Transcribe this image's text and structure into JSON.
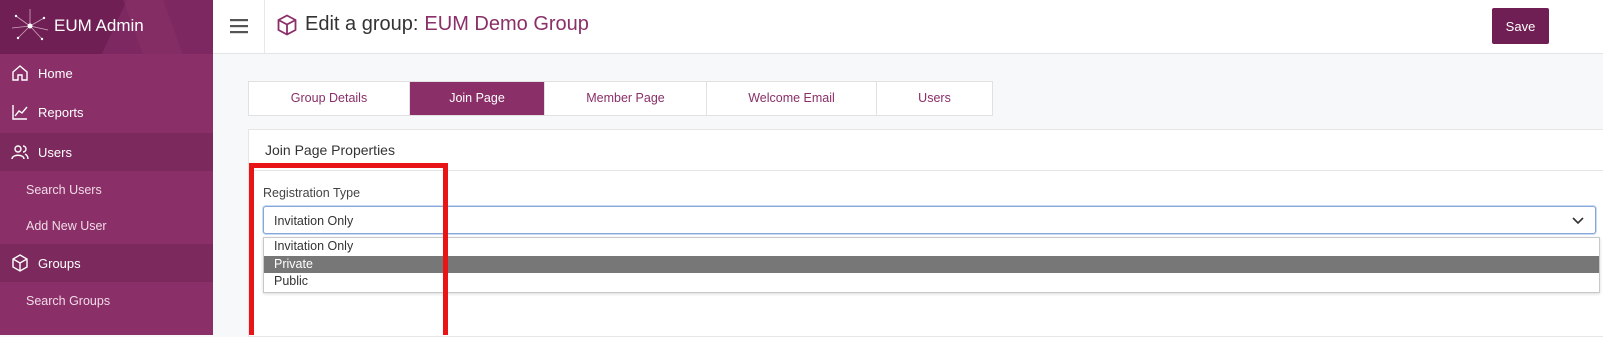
{
  "app": {
    "title": "EUM Admin"
  },
  "sidebar": {
    "items": [
      {
        "label": "Home",
        "icon": "home-icon"
      },
      {
        "label": "Reports",
        "icon": "chart-line-icon"
      },
      {
        "label": "Users",
        "icon": "users-icon"
      },
      {
        "label": "Search Users"
      },
      {
        "label": "Add New User"
      },
      {
        "label": "Groups",
        "icon": "cube-icon"
      },
      {
        "label": "Search Groups"
      }
    ]
  },
  "header": {
    "title_prefix": "Edit a group:",
    "group_name": "EUM Demo Group",
    "save_label": "Save"
  },
  "tabs": [
    {
      "label": "Group Details"
    },
    {
      "label": "Join Page",
      "active": true
    },
    {
      "label": "Member Page"
    },
    {
      "label": "Welcome Email"
    },
    {
      "label": "Users"
    }
  ],
  "panel": {
    "title": "Join Page Properties",
    "registration": {
      "label": "Registration Type",
      "value": "Invitation Only",
      "options": [
        "Invitation Only",
        "Private",
        "Public"
      ],
      "highlighted": "Private"
    }
  },
  "colors": {
    "brand": "#8a2f68",
    "brand_dark": "#6f1f53",
    "annotation": "#e81416"
  }
}
